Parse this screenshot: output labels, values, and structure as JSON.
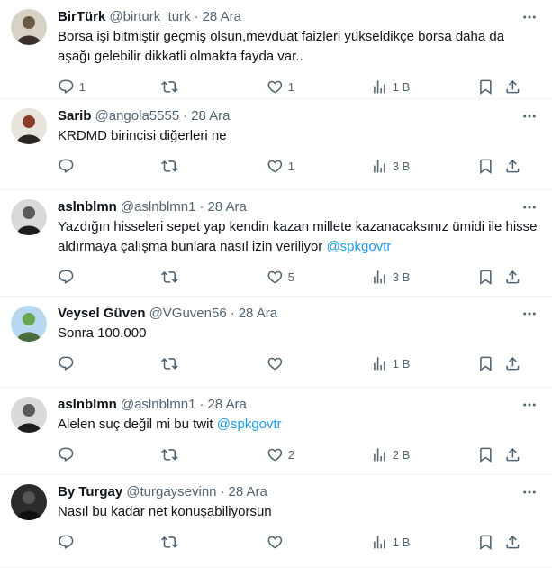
{
  "tweets": [
    {
      "name": "BirTürk",
      "handle": "@birturk_turk",
      "date": "28 Ara",
      "text": "Borsa işi bitmiştir geçmiş olsun,mevduat faizleri yükseldikçe borsa daha da aşağı gelebilir dikkatli olmakta fayda var..",
      "mention": "",
      "replies": "1",
      "retweets": "",
      "likes": "1",
      "views": "1 B"
    },
    {
      "name": "Sarib",
      "handle": "@angola5555",
      "date": "28 Ara",
      "text": "KRDMD birincisi diğerleri ne",
      "mention": "",
      "replies": "",
      "retweets": "",
      "likes": "1",
      "views": "3 B"
    },
    {
      "name": "aslnblmn",
      "handle": "@aslnblmn1",
      "date": "28 Ara",
      "text": "Yazdığın hisseleri sepet yap kendin kazan millete kazanacaksınız ümidi ile hisse aldırmaya çalışma bunlara nasıl izin veriliyor ",
      "mention": "@spkgovtr",
      "replies": "",
      "retweets": "",
      "likes": "5",
      "views": "3 B"
    },
    {
      "name": "Veysel Güven",
      "handle": "@VGuven56",
      "date": "28 Ara",
      "text": "Sonra 100.000",
      "mention": "",
      "replies": "",
      "retweets": "",
      "likes": "",
      "views": "1 B"
    },
    {
      "name": "aslnblmn",
      "handle": "@aslnblmn1",
      "date": "28 Ara",
      "text": "Alelen suç değil mi bu twit ",
      "mention": "@spkgovtr",
      "replies": "",
      "retweets": "",
      "likes": "2",
      "views": "2 B"
    },
    {
      "name": "By Turgay",
      "handle": "@turgaysevinn",
      "date": "28 Ara",
      "text": "Nasıl bu kadar net konuşabiliyorsun",
      "mention": "",
      "replies": "",
      "retweets": "",
      "likes": "",
      "views": "1 B"
    }
  ],
  "separator": "·",
  "colors": {
    "text": "#0f1419",
    "secondary": "#536471",
    "link": "#1d9bf0",
    "border": "#eff3f4"
  }
}
